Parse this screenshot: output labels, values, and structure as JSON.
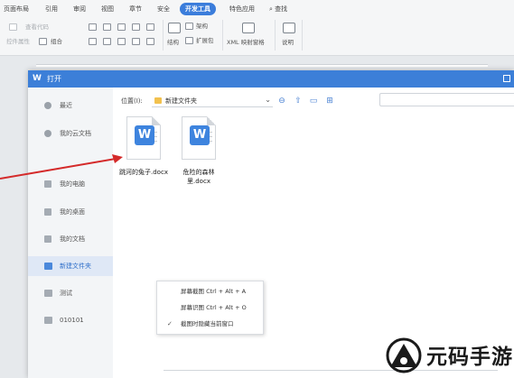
{
  "ribbon": {
    "tabs": [
      {
        "label": "页面布局"
      },
      {
        "label": "引用"
      },
      {
        "label": "审阅"
      },
      {
        "label": "视图"
      },
      {
        "label": "章节"
      },
      {
        "label": "安全"
      },
      {
        "label": "开发工具",
        "active": true
      },
      {
        "label": "特色应用"
      }
    ],
    "search_label": "查找",
    "tools": {
      "view_code": "查看代码",
      "control_props": "控件属性",
      "group": "组合",
      "structure": "结构",
      "schema": "架构",
      "expansion_pack": "扩展包",
      "xml_mapping_pane": "XML 映射窗格",
      "help": "说明"
    }
  },
  "dialog": {
    "title": "打开",
    "accent_color": "#3c7fd8",
    "sidebar": [
      {
        "label": "最近",
        "icon": "clock-icon"
      },
      {
        "label": "我的云文档",
        "icon": "cloud-icon"
      },
      {
        "label": "我的电脑",
        "icon": "computer-icon"
      },
      {
        "label": "我的桌面",
        "icon": "desktop-icon"
      },
      {
        "label": "我的文档",
        "icon": "document-icon"
      },
      {
        "label": "新建文件夹",
        "icon": "folder-icon",
        "active": true
      },
      {
        "label": "测试",
        "icon": "folder-icon"
      },
      {
        "label": "010101",
        "icon": "folder-icon"
      }
    ],
    "location_label": "位置(I):",
    "location_value": "新建文件夹",
    "files": [
      {
        "name": "跳河的兔子.docx",
        "icon": "word-doc-icon"
      },
      {
        "name": "危险的森林里.docx",
        "icon": "word-doc-icon"
      }
    ],
    "context_menu": [
      {
        "label": "屏幕截图 Ctrl + Alt + A",
        "checked": false
      },
      {
        "label": "屏幕识图 Ctrl + Alt + O",
        "checked": false
      },
      {
        "label": "截图时隐藏当前窗口",
        "checked": true
      }
    ]
  },
  "watermark": {
    "text": "元码手游网"
  }
}
